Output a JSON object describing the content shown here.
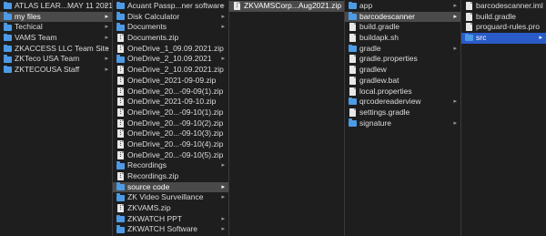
{
  "columns": [
    {
      "items": [
        {
          "label": "ATLAS LEAR...MAY 11 2021",
          "kind": "folder",
          "icon": "folder-icon",
          "chevron": true
        },
        {
          "label": "my files",
          "kind": "folder",
          "icon": "folder-icon",
          "chevron": true,
          "selected": "inactive"
        },
        {
          "label": "Techical",
          "kind": "folder",
          "icon": "folder-icon",
          "chevron": true
        },
        {
          "label": "VAMS Team",
          "kind": "folder",
          "icon": "folder-icon",
          "chevron": true
        },
        {
          "label": "ZKACCESS LLC Team Site",
          "kind": "folder",
          "icon": "folder-icon",
          "chevron": true
        },
        {
          "label": "ZKTeco USA Team",
          "kind": "folder",
          "icon": "folder-icon",
          "chevron": true
        },
        {
          "label": "ZKTECOUSA Staff",
          "kind": "folder",
          "icon": "folder-icon",
          "chevron": true
        }
      ]
    },
    {
      "items": [
        {
          "label": "Acuant Passp...ner software",
          "kind": "folder",
          "icon": "folder-icon",
          "chevron": true
        },
        {
          "label": "Disk Calculator",
          "kind": "folder",
          "icon": "folder-icon",
          "chevron": true
        },
        {
          "label": "Documents",
          "kind": "folder",
          "icon": "folder-icon",
          "chevron": true
        },
        {
          "label": "Documents.zip",
          "kind": "zip",
          "icon": "zip-file-icon"
        },
        {
          "label": "OneDrive_1_09.09.2021.zip",
          "kind": "zip",
          "icon": "zip-file-icon"
        },
        {
          "label": "OneDrive_2_10.09.2021",
          "kind": "folder",
          "icon": "folder-icon",
          "chevron": true
        },
        {
          "label": "OneDrive_2_10.09.2021.zip",
          "kind": "zip",
          "icon": "zip-file-icon"
        },
        {
          "label": "OneDrive_2021-09-09.zip",
          "kind": "zip",
          "icon": "zip-file-icon"
        },
        {
          "label": "OneDrive_20...-09-09(1).zip",
          "kind": "zip",
          "icon": "zip-file-icon"
        },
        {
          "label": "OneDrive_2021-09-10.zip",
          "kind": "zip",
          "icon": "zip-file-icon"
        },
        {
          "label": "OneDrive_20...-09-10(1).zip",
          "kind": "zip",
          "icon": "zip-file-icon"
        },
        {
          "label": "OneDrive_20...-09-10(2).zip",
          "kind": "zip",
          "icon": "zip-file-icon"
        },
        {
          "label": "OneDrive_20...-09-10(3).zip",
          "kind": "zip",
          "icon": "zip-file-icon"
        },
        {
          "label": "OneDrive_20...-09-10(4).zip",
          "kind": "zip",
          "icon": "zip-file-icon"
        },
        {
          "label": "OneDrive_20...-09-10(5).zip",
          "kind": "zip",
          "icon": "zip-file-icon"
        },
        {
          "label": "Recordings",
          "kind": "folder",
          "icon": "folder-icon",
          "chevron": true
        },
        {
          "label": "Recordings.zip",
          "kind": "zip",
          "icon": "zip-file-icon"
        },
        {
          "label": "source code",
          "kind": "folder",
          "icon": "folder-icon",
          "chevron": true,
          "selected": "inactive"
        },
        {
          "label": "ZK Video Surveillance",
          "kind": "folder",
          "icon": "folder-icon",
          "chevron": true
        },
        {
          "label": "ZKVAMS.zip",
          "kind": "zip",
          "icon": "zip-file-icon"
        },
        {
          "label": "ZKWATCH PPT",
          "kind": "folder",
          "icon": "folder-icon",
          "chevron": true
        },
        {
          "label": "ZKWATCH Software",
          "kind": "folder",
          "icon": "folder-icon",
          "chevron": true
        }
      ]
    },
    {
      "items": [
        {
          "label": "ZKVAMSCorp...Aug2021.zip",
          "kind": "zip",
          "icon": "zip-file-icon",
          "selected": "inactive"
        }
      ]
    },
    {
      "items": [
        {
          "label": "app",
          "kind": "folder",
          "icon": "folder-icon",
          "chevron": true
        },
        {
          "label": "barcodescanner",
          "kind": "folder",
          "icon": "folder-icon",
          "chevron": true,
          "selected": "inactive"
        },
        {
          "label": "build.gradle",
          "kind": "file",
          "icon": "file-icon"
        },
        {
          "label": "buildapk.sh",
          "kind": "file",
          "icon": "file-icon"
        },
        {
          "label": "gradle",
          "kind": "folder",
          "icon": "folder-icon",
          "chevron": true
        },
        {
          "label": "gradle.properties",
          "kind": "file",
          "icon": "file-icon"
        },
        {
          "label": "gradlew",
          "kind": "file",
          "icon": "file-icon"
        },
        {
          "label": "gradlew.bat",
          "kind": "file",
          "icon": "file-icon"
        },
        {
          "label": "local.properties",
          "kind": "file",
          "icon": "file-icon"
        },
        {
          "label": "qrcodereaderview",
          "kind": "folder",
          "icon": "folder-icon",
          "chevron": true
        },
        {
          "label": "settings.gradle",
          "kind": "file",
          "icon": "file-icon"
        },
        {
          "label": "signature",
          "kind": "folder",
          "icon": "folder-icon",
          "chevron": true
        }
      ]
    },
    {
      "items": [
        {
          "label": "barcodescanner.iml",
          "kind": "file",
          "icon": "file-icon"
        },
        {
          "label": "build.gradle",
          "kind": "file",
          "icon": "file-icon"
        },
        {
          "label": "proguard-rules.pro",
          "kind": "file",
          "icon": "file-icon"
        },
        {
          "label": "src",
          "kind": "folder",
          "icon": "folder-icon",
          "chevron": true,
          "selected": "active"
        }
      ]
    }
  ]
}
